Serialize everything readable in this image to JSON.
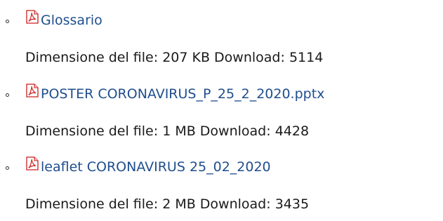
{
  "files": [
    {
      "icon": "pdf-file-icon",
      "link_text": "Glossario",
      "size_label": "Dimensione del file:",
      "size_value": "207 KB",
      "downloads_label": "Download:",
      "downloads_value": "5114"
    },
    {
      "icon": "pdf-file-icon",
      "link_text": "POSTER CORONAVIRUS_P_25_2_2020.pptx",
      "size_label": "Dimensione del file:",
      "size_value": "1 MB",
      "downloads_label": "Download:",
      "downloads_value": "4428"
    },
    {
      "icon": "pdf-file-icon",
      "link_text": "leaflet CORONAVIRUS 25_02_2020",
      "size_label": "Dimensione del file:",
      "size_value": "2 MB",
      "downloads_label": "Download:",
      "downloads_value": "3435"
    }
  ],
  "colors": {
    "link": "#1f4e8e",
    "text": "#1a1a1a",
    "pdf_red": "#cc1f1f"
  }
}
